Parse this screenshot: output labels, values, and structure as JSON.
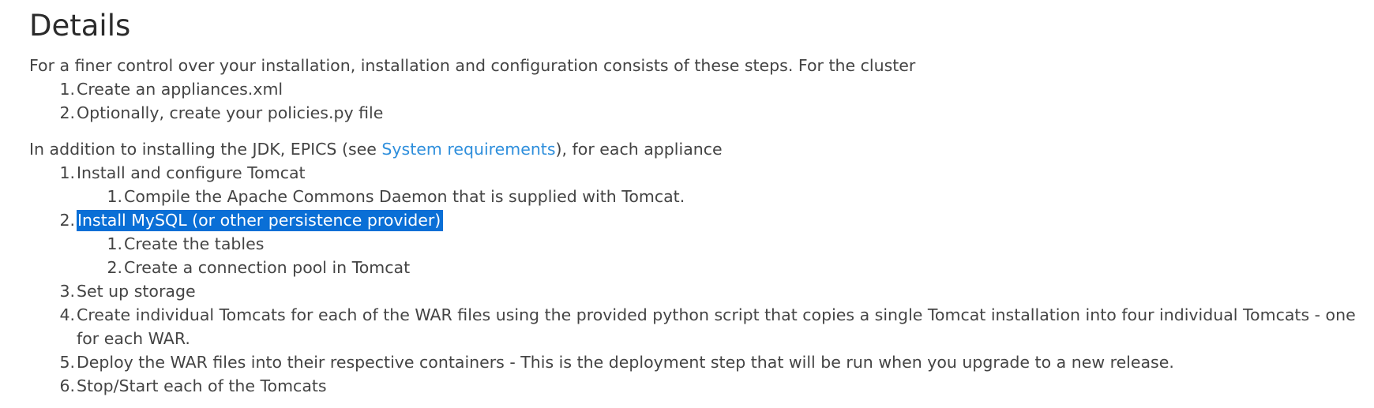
{
  "heading": "Details",
  "intro": "For a finer control over your installation, installation and configuration consists of these steps. For the cluster",
  "cluster_steps": [
    {
      "num": "1.",
      "text": "Create an appliances.xml"
    },
    {
      "num": "2.",
      "text": "Optionally, create your policies.py file"
    }
  ],
  "appliance_intro": {
    "before": "In addition to installing the JDK, EPICS (see ",
    "link": "System requirements",
    "after": "), for each appliance"
  },
  "appliance_steps": [
    {
      "num": "1.",
      "text": "Install and configure Tomcat"
    },
    {
      "num": "1.",
      "text": "Compile the Apache Commons Daemon that is supplied with Tomcat."
    },
    {
      "num": "2.",
      "text": "Install MySQL (or other persistence provider)"
    },
    {
      "num": "1.",
      "text": "Create the tables"
    },
    {
      "num": "2.",
      "text": "Create a connection pool in Tomcat"
    },
    {
      "num": "3.",
      "text": "Set up storage"
    },
    {
      "num": "4.",
      "text": "Create individual Tomcats for each of the WAR files using the provided python script that copies a single Tomcat installation into four individual Tomcats - one for each WAR."
    },
    {
      "num": "5.",
      "text": "Deploy the WAR files into their respective containers - This is the deployment step that will be run when you upgrade to a new release."
    },
    {
      "num": "6.",
      "text": "Stop/Start each of the Tomcats"
    }
  ],
  "colors": {
    "link": "#2f8fdc",
    "selection": "#0a6fd6",
    "text": "#444444"
  }
}
